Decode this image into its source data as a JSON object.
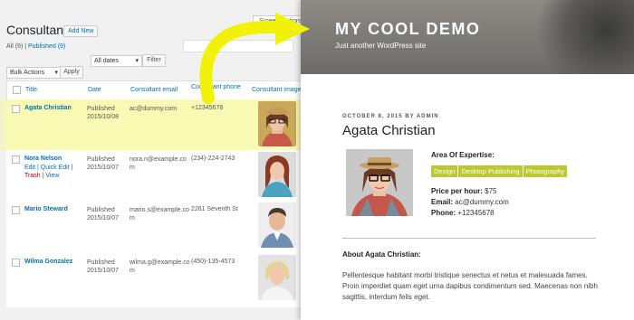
{
  "admin": {
    "title": "Consultants",
    "add_new": "Add New",
    "filter_all": "All (9)",
    "filter_sep": " | ",
    "filter_published": "Published (9)",
    "screen_options": "Screen Options ▾",
    "all_dates": "All dates",
    "filter_button": "Filter",
    "bulk_actions": "Bulk Actions",
    "apply": "Apply",
    "columns": [
      "Title",
      "Date",
      "Consultant email",
      "Consultant phone",
      "Consultant image"
    ],
    "rows": [
      {
        "name": "Agata Christian",
        "status": "Published",
        "date": "2015/10/08",
        "email_1": "ac@dummy.com",
        "email_2": "",
        "phone": "+12345678"
      },
      {
        "name": "Nora Nelson",
        "status": "Published",
        "date": "2015/10/07",
        "email_1": "nora.n@example.co",
        "email_2": "m",
        "phone": "(234)-224-2743",
        "edit": "Edit",
        "quick_edit": "Quick Edit",
        "trash": "Trash",
        "view": "View"
      },
      {
        "name": "Mario Steward",
        "status": "Published",
        "date": "2015/10/07",
        "email_1": "mario.s@example.co",
        "email_2": "m",
        "phone": "2261 Seventh St"
      },
      {
        "name": "Wilma Gonzalez",
        "status": "Published",
        "date": "2015/10/07",
        "email_1": "wilma.g@example.co",
        "email_2": "m",
        "phone": "(450)-135-4573"
      }
    ]
  },
  "front": {
    "site_title": "MY COOL DEMO",
    "site_description": "Just another WordPress site",
    "post_meta": "OCTOBER 8, 2015 BY ADMIN",
    "post_title": "Agata Christian",
    "expertise_label": "Area Of Expertise:",
    "tags": [
      "Design",
      "Desktop Publishing",
      "Photography"
    ],
    "price_label": "Price per hour:",
    "price_value": "$75",
    "email_label": "Email:",
    "email_value": "ac@dummy.com",
    "phone_label": "Phone:",
    "phone_value": "+12345678",
    "about_title": "About Agata Christian:",
    "about_text": "Pellentesque habitant morbi tristique senectus et netus et malesuada fames. Proin imperdiet quam eget urna dapibus condimentum sed. Maecenas non nibh sagittis, interdum felis eget."
  },
  "colors": {
    "highlight": "#f6f7a2",
    "arrow": "#f1f10a",
    "tag": "#bcc832",
    "link": "#0073aa"
  }
}
